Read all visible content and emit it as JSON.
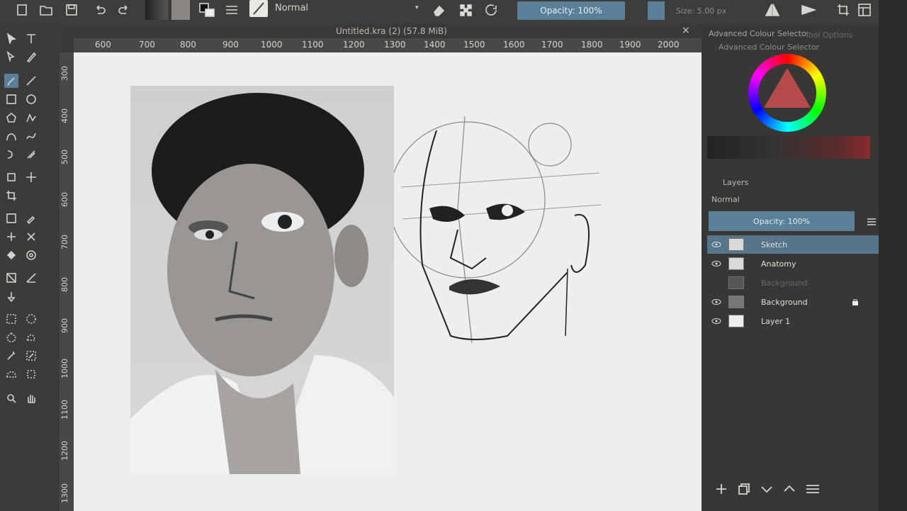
{
  "toolbar": {
    "blend_mode": "Normal",
    "opacity_label": "Opacity: 100%",
    "size_label": "Size: 5.00 px"
  },
  "document": {
    "title": "Untitled.kra (2) (57.8 MiB)",
    "close": "×"
  },
  "ruler": {
    "top": [
      "600",
      "700",
      "800",
      "900",
      "1000",
      "1100",
      "1200",
      "1300",
      "1400",
      "1500",
      "1600",
      "1700",
      "1800",
      "1900",
      "2000"
    ],
    "left": [
      "300",
      "400",
      "500",
      "600",
      "700",
      "800",
      "900",
      "1000",
      "1100",
      "1200",
      "1300"
    ]
  },
  "docker": {
    "tab_colour": "Advanced Colour Selector",
    "tab_tool": "Tool Options",
    "colour_header": "Advanced Colour Selector",
    "layers_header": "Layers",
    "blend_mode": "Normal",
    "opacity_label": "Opacity:  100%",
    "layers": [
      {
        "name": "Sketch",
        "active": true,
        "visible": true
      },
      {
        "name": "Anatomy",
        "active": false,
        "visible": true
      },
      {
        "name": "Background",
        "active": false,
        "visible": false
      },
      {
        "name": "Background",
        "active": false,
        "visible": true
      },
      {
        "name": "Layer 1",
        "active": false,
        "visible": true
      }
    ]
  },
  "colors": {
    "accent": "#5a7f99",
    "panel": "#393735",
    "canvas": "#eeeeed"
  }
}
